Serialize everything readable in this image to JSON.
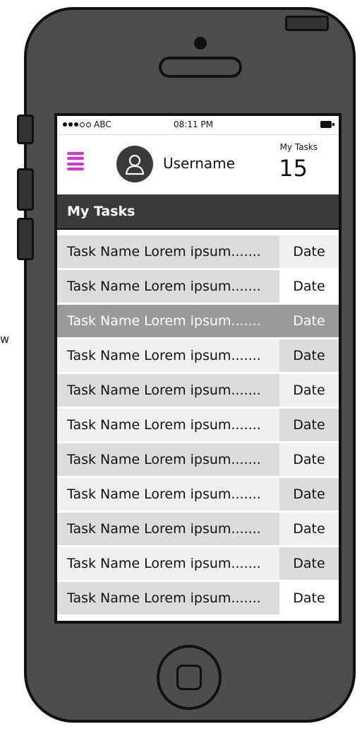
{
  "stray_text": "w",
  "status_bar": {
    "carrier": "ABC",
    "time": "08:11 PM"
  },
  "header": {
    "menu_icon": "hamburger-menu-icon",
    "avatar_icon": "user-avatar-icon",
    "username": "Username",
    "tasks_label": "My Tasks",
    "tasks_count": "15"
  },
  "section": {
    "title": "My Tasks"
  },
  "tasks": [
    {
      "name": "Task Name Lorem ipsum.......",
      "date": "Date"
    },
    {
      "name": "Task Name Lorem ipsum.......",
      "date": "Date"
    },
    {
      "name": "Task Name Lorem ipsum.......",
      "date": "Date",
      "selected": true
    },
    {
      "name": "Task Name Lorem ipsum.......",
      "date": "Date"
    },
    {
      "name": "Task Name Lorem ipsum.......",
      "date": "Date"
    },
    {
      "name": "Task Name Lorem ipsum.......",
      "date": "Date"
    },
    {
      "name": "Task Name Lorem ipsum.......",
      "date": "Date"
    },
    {
      "name": "Task Name Lorem ipsum.......",
      "date": "Date"
    },
    {
      "name": "Task Name Lorem ipsum.......",
      "date": "Date"
    },
    {
      "name": "Task Name Lorem ipsum.......",
      "date": "Date"
    },
    {
      "name": "Task Name Lorem ipsum.......",
      "date": "Date"
    }
  ],
  "colors": {
    "accent": "#e02fd6",
    "header_bg": "#3a3a3a",
    "selected_row": "#9a9a9a",
    "phone_body": "#4d4d4d"
  }
}
